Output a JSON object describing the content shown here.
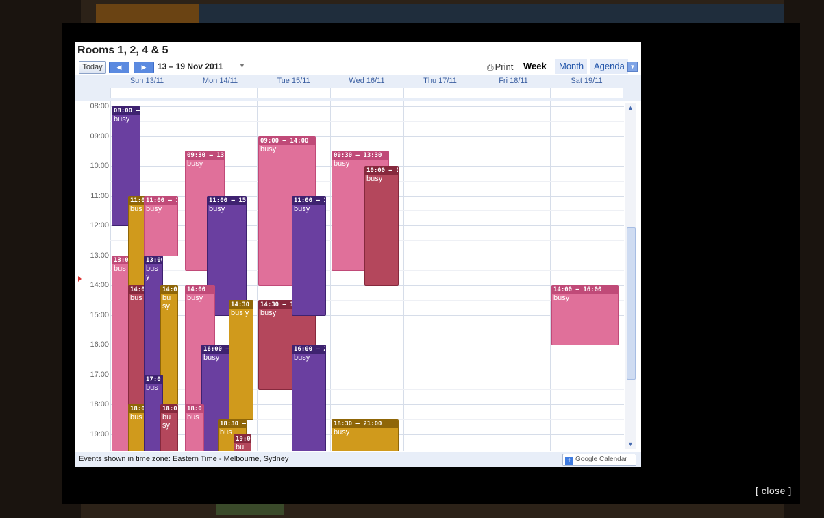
{
  "window": {
    "close_label": "[ close ]"
  },
  "calendar": {
    "title": "Rooms 1, 2, 4 & 5",
    "today_label": "Today",
    "prev_icon": "◀",
    "next_icon": "▶",
    "date_range": "13 – 19 Nov 2011",
    "print_label": "Print",
    "tabs": [
      "Week",
      "Month",
      "Agenda"
    ],
    "active_tab": "Week",
    "days": [
      "Sun 13/11",
      "Mon 14/11",
      "Tue 15/11",
      "Wed 16/11",
      "Thu 17/11",
      "Fri 18/11",
      "Sat 19/11"
    ],
    "hours": [
      "08:00",
      "09:00",
      "10:00",
      "11:00",
      "12:00",
      "13:00",
      "14:00",
      "15:00",
      "16:00",
      "17:00",
      "18:00",
      "19:00"
    ],
    "timezone_note": "Events shown in time zone: Eastern Time - Melbourne, Sydney",
    "badge_label": "Google Calendar",
    "colors": {
      "purple": "#6a3fa0",
      "pink": "#e0709a",
      "red": "#b4475c",
      "gold": "#d09a1c"
    },
    "events": [
      {
        "day": 0,
        "start": 8.0,
        "end": 12.0,
        "time": "08:00 –",
        "label": "busy",
        "color": "purple"
      },
      {
        "day": 0,
        "start": 13.0,
        "end": 20.5,
        "time": "13:0",
        "label": "bus",
        "color": "pink"
      },
      {
        "day": 0,
        "start": 11.0,
        "end": 20.5,
        "time": "11:0",
        "label": "bus",
        "color": "gold"
      },
      {
        "day": 0,
        "start": 14.0,
        "end": 18.0,
        "time": "14:0",
        "label": "bus",
        "color": "red"
      },
      {
        "day": 0,
        "start": 18.0,
        "end": 20.5,
        "time": "18:0",
        "label": "bus",
        "color": "gold"
      },
      {
        "day": 0,
        "start": 11.0,
        "end": 13.0,
        "time": "11:00 – 1",
        "label": "busy",
        "color": "pink"
      },
      {
        "day": 0,
        "start": 13.0,
        "end": 20.5,
        "time": "13:00 –",
        "label": "busy",
        "color": "purple"
      },
      {
        "day": 0,
        "start": 14.0,
        "end": 18.0,
        "time": "14:0",
        "label": "bu sy",
        "color": "gold"
      },
      {
        "day": 0,
        "start": 17.0,
        "end": 20.5,
        "time": "17:0",
        "label": "bus",
        "color": "purple"
      },
      {
        "day": 0,
        "start": 18.0,
        "end": 20.5,
        "time": "18:0",
        "label": "bu sy",
        "color": "red"
      },
      {
        "day": 1,
        "start": 9.5,
        "end": 13.5,
        "time": "09:30 – 13",
        "label": "busy",
        "color": "pink"
      },
      {
        "day": 1,
        "start": 11.0,
        "end": 15.0,
        "time": "11:00 – 15",
        "label": "busy",
        "color": "purple"
      },
      {
        "day": 1,
        "start": 14.0,
        "end": 20.5,
        "time": "14:00",
        "label": "busy",
        "color": "pink"
      },
      {
        "day": 1,
        "start": 16.0,
        "end": 20.5,
        "time": "16:00 –",
        "label": "busy",
        "color": "purple"
      },
      {
        "day": 1,
        "start": 14.5,
        "end": 18.5,
        "time": "14:30",
        "label": "bus y",
        "color": "gold"
      },
      {
        "day": 1,
        "start": 18.0,
        "end": 20.5,
        "time": "18:0",
        "label": "bus",
        "color": "pink"
      },
      {
        "day": 1,
        "start": 18.5,
        "end": 20.5,
        "time": "18:30 –",
        "label": "bus",
        "color": "gold"
      },
      {
        "day": 1,
        "start": 19.0,
        "end": 20.5,
        "time": "19:0",
        "label": "bu",
        "color": "red"
      },
      {
        "day": 2,
        "start": 9.0,
        "end": 14.0,
        "time": "09:00 – 14:00",
        "label": "busy",
        "color": "pink"
      },
      {
        "day": 2,
        "start": 14.5,
        "end": 17.5,
        "time": "14:30 – 1",
        "label": "busy",
        "color": "red"
      },
      {
        "day": 2,
        "start": 11.0,
        "end": 15.0,
        "time": "11:00 – 1",
        "label": "busy",
        "color": "purple"
      },
      {
        "day": 2,
        "start": 16.0,
        "end": 20.5,
        "time": "16:00 – 2",
        "label": "busy",
        "color": "purple"
      },
      {
        "day": 3,
        "start": 9.5,
        "end": 13.5,
        "time": "09:30 – 13:30",
        "label": "busy",
        "color": "pink"
      },
      {
        "day": 3,
        "start": 10.0,
        "end": 14.0,
        "time": "10:00 – 1",
        "label": "busy",
        "color": "red"
      },
      {
        "day": 3,
        "start": 18.5,
        "end": 20.5,
        "time": "18:30 – 21:00",
        "label": "busy",
        "color": "gold"
      },
      {
        "day": 6,
        "start": 14.0,
        "end": 16.0,
        "time": "14:00 – 16:00",
        "label": "busy",
        "color": "pink"
      }
    ]
  }
}
